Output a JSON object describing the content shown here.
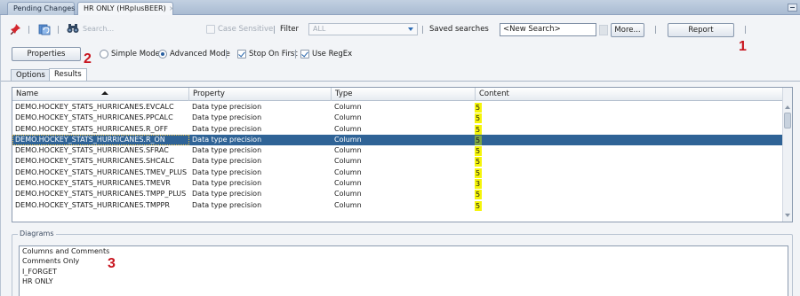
{
  "tabs": [
    {
      "label": "Pending Changes"
    },
    {
      "label": "HR ONLY (HRplusBEER)",
      "close": "×"
    }
  ],
  "toolbar": {
    "search_placeholder": "Search...",
    "case_sensitive_label": "Case Sensitive",
    "filter_label": "Filter",
    "filter_value": "ALL",
    "saved_searches_label": "Saved searches",
    "saved_search_value": "<New Search>",
    "more_button": "More...",
    "report_button": "Report",
    "marker_1": "1"
  },
  "mode_row": {
    "properties_button": "Properties",
    "marker_2": "2",
    "simple_mode_label": "Simple Mode",
    "advanced_mode_label": "Advanced Mode",
    "stop_on_first_label": "Stop On First",
    "use_regex_label": "Use RegEx",
    "advanced_selected": true,
    "stop_on_first_checked": true,
    "use_regex_checked": true
  },
  "subtabs": [
    {
      "label": "Options"
    },
    {
      "label": "Results"
    }
  ],
  "results": {
    "columns": [
      "Name",
      "Property",
      "Type",
      "Content"
    ],
    "rows": [
      {
        "name": "DEMO.HOCKEY_STATS_HURRICANES.EVCALC",
        "property": "Data type precision",
        "type": "Column",
        "content": "5"
      },
      {
        "name": "DEMO.HOCKEY_STATS_HURRICANES.PPCALC",
        "property": "Data type precision",
        "type": "Column",
        "content": "5"
      },
      {
        "name": "DEMO.HOCKEY_STATS_HURRICANES.R_OFF",
        "property": "Data type precision",
        "type": "Column",
        "content": "5"
      },
      {
        "name": "DEMO.HOCKEY_STATS_HURRICANES.R_ON",
        "property": "Data type precision",
        "type": "Column",
        "content": "5"
      },
      {
        "name": "DEMO.HOCKEY_STATS_HURRICANES.SFRAC",
        "property": "Data type precision",
        "type": "Column",
        "content": "5"
      },
      {
        "name": "DEMO.HOCKEY_STATS_HURRICANES.SHCALC",
        "property": "Data type precision",
        "type": "Column",
        "content": "5"
      },
      {
        "name": "DEMO.HOCKEY_STATS_HURRICANES.TMEV_PLUS",
        "property": "Data type precision",
        "type": "Column",
        "content": "5"
      },
      {
        "name": "DEMO.HOCKEY_STATS_HURRICANES.TMEVR",
        "property": "Data type precision",
        "type": "Column",
        "content": "3"
      },
      {
        "name": "DEMO.HOCKEY_STATS_HURRICANES.TMPP_PLUS",
        "property": "Data type precision",
        "type": "Column",
        "content": "5"
      },
      {
        "name": "DEMO.HOCKEY_STATS_HURRICANES.TMPPR",
        "property": "Data type precision",
        "type": "Column",
        "content": "5"
      }
    ]
  },
  "diagrams": {
    "title": "Diagrams",
    "items": [
      "Columns and Comments",
      "Comments Only",
      "I_FORGET",
      "HR ONLY"
    ],
    "marker_3": "3"
  },
  "colors": {
    "selected_row": "#2f6396",
    "highlight": "#f5f50a",
    "marker": "#c8141e"
  }
}
